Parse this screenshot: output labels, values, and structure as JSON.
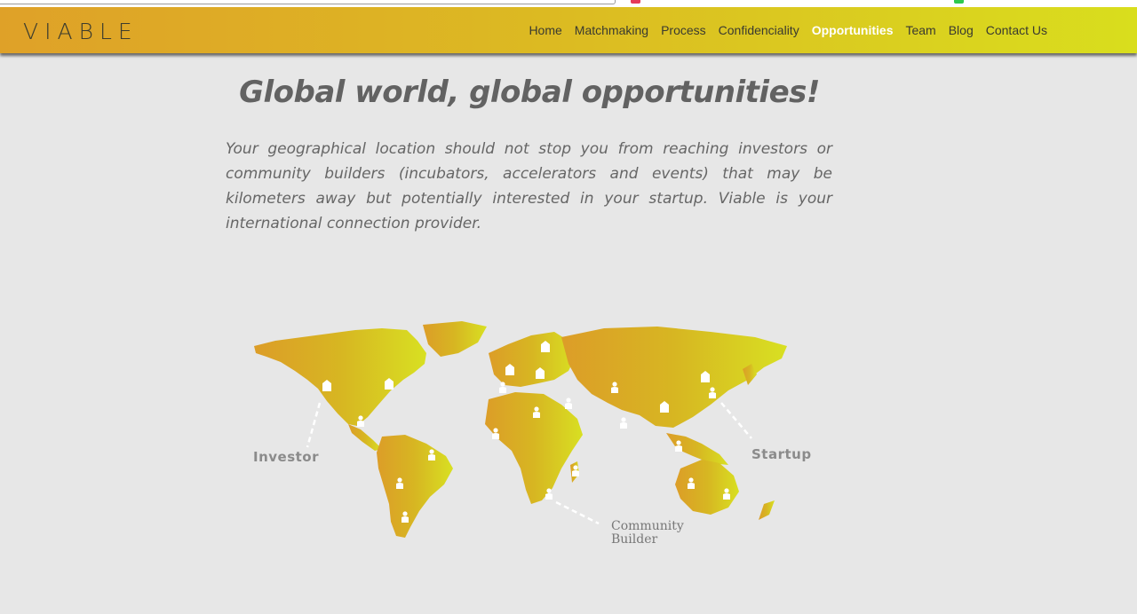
{
  "brand": {
    "logo_text": "VIABLE"
  },
  "nav": {
    "items": [
      {
        "label": "Home",
        "active": false
      },
      {
        "label": "Matchmaking",
        "active": false
      },
      {
        "label": "Process",
        "active": false
      },
      {
        "label": "Confidenciality",
        "active": false
      },
      {
        "label": "Opportunities",
        "active": true
      },
      {
        "label": "Team",
        "active": false
      },
      {
        "label": "Blog",
        "active": false
      },
      {
        "label": "Contact Us",
        "active": false
      }
    ]
  },
  "content": {
    "headline": "Global world, global opportunities!",
    "intro": "Your geographical location should not stop you from reaching investors or community builders (incubators, accelerators and events) that may be kilometers away but potentially interested in your startup. Viable is your international connection provider."
  },
  "map": {
    "labels": {
      "investor": "Investor",
      "startup": "Startup",
      "community_line1": "Community",
      "community_line2": "Builder"
    }
  },
  "colors": {
    "gradient_start": "#dfa128",
    "gradient_end": "#d9de1d",
    "background": "#e7e7e7",
    "active_nav": "#ffffff"
  }
}
